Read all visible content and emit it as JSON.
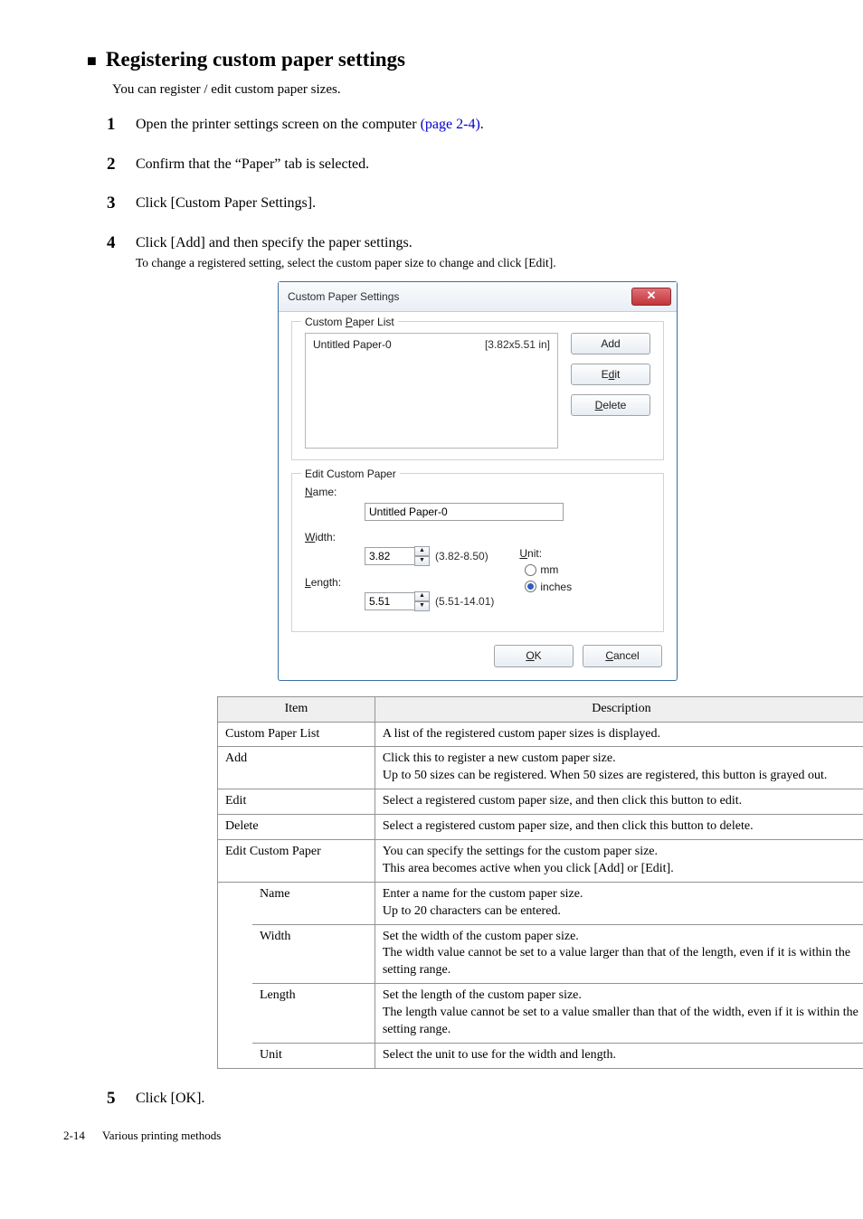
{
  "heading": "Registering custom paper settings",
  "intro": "You can register / edit custom paper sizes.",
  "steps": {
    "s1_a": "Open the printer settings screen on the computer ",
    "s1_link": "(page 2-4)",
    "s1_b": ".",
    "s2": "Confirm that the “Paper” tab is selected.",
    "s3": "Click [Custom Paper Settings].",
    "s4": "Click [Add] and then specify the paper settings.",
    "s4_sub": "To change a registered setting, select the custom paper size to change and click [Edit].",
    "s5": "Click [OK]."
  },
  "dialog": {
    "title": "Custom Paper Settings",
    "group1": "Custom Paper List",
    "list_item_name": "Untitled Paper-0",
    "list_item_size": "[3.82x5.51 in]",
    "btn_add": "Add",
    "btn_edit_pre": "E",
    "btn_edit_accel": "d",
    "btn_edit_post": "it",
    "btn_delete_accel": "D",
    "btn_delete_post": "elete",
    "group2": "Edit Custom Paper",
    "name_label_accel": "N",
    "name_label_post": "ame:",
    "name_value": "Untitled Paper-0",
    "width_label_accel": "W",
    "width_label_post": "idth:",
    "width_value": "3.82",
    "width_range": "(3.82-8.50)",
    "length_label_accel": "L",
    "length_label_post": "ength:",
    "length_value": "5.51",
    "length_range": "(5.51-14.01)",
    "unit_label_accel": "U",
    "unit_label_post": "nit:",
    "unit_mm": "mm",
    "unit_in": "inches",
    "ok_accel": "O",
    "ok_post": "K",
    "cancel_accel": "C",
    "cancel_post": "ancel"
  },
  "table": {
    "h_item": "Item",
    "h_desc": "Description",
    "rows": {
      "cpl_item": "Custom Paper List",
      "cpl_desc": "A list of the registered custom paper sizes is displayed.",
      "add_item": "Add",
      "add_desc": "Click this to register a new custom paper size.\nUp to 50 sizes can be registered. When 50 sizes are registered, this button is grayed out.",
      "edit_item": "Edit",
      "edit_desc": "Select a registered custom paper size, and then click this button to edit.",
      "del_item": "Delete",
      "del_desc": "Select a registered custom paper size, and then click this button to delete.",
      "ecp_item": "Edit Custom Paper",
      "ecp_desc": "You can specify the settings for the custom paper size.\nThis area becomes active when you click [Add] or [Edit].",
      "name_item": "Name",
      "name_desc": "Enter a name for the custom paper size.\nUp to 20 characters can be entered.",
      "width_item": "Width",
      "width_desc": "Set the width of the custom paper size.\nThe width value cannot be set to a value larger than that of the length, even if it is within the setting range.",
      "length_item": "Length",
      "length_desc": "Set the length of the custom paper size.\nThe length value cannot be set to a value smaller than that of the width, even if it is within the setting range.",
      "unit_item": "Unit",
      "unit_desc": "Select the unit to use for the width and length."
    }
  },
  "footer": {
    "page": "2-14",
    "section": "Various printing methods"
  }
}
